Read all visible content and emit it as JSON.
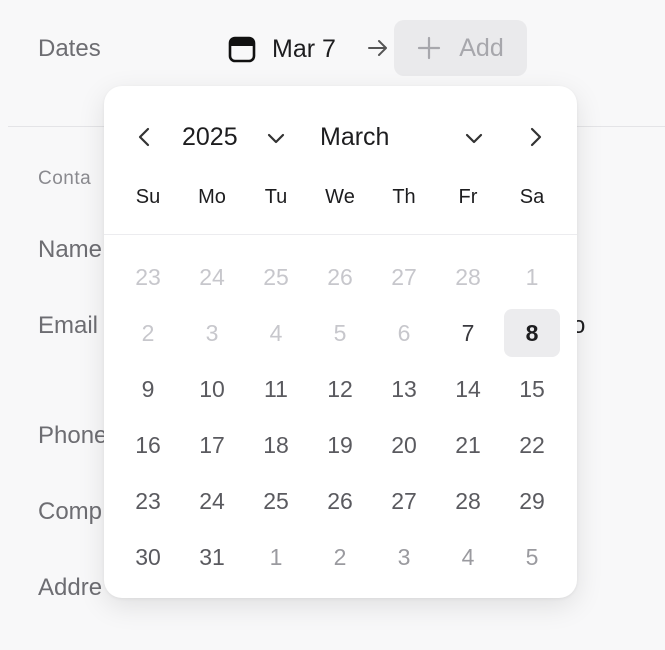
{
  "form": {
    "dates_label": "Dates",
    "section_label": "Conta",
    "name_label": "Name",
    "email_label": "Email",
    "email_value_tail": "co",
    "phone_label": "Phone",
    "company_label": "Comp",
    "address_label": "Addre"
  },
  "date_range": {
    "start_icon": "calendar-icon",
    "start_value": "Mar 7",
    "arrow_icon": "arrow-right-icon",
    "add_icon": "plus-icon",
    "add_label": "Add"
  },
  "calendar": {
    "prev_icon": "chevron-left-icon",
    "next_icon": "chevron-right-icon",
    "year": "2025",
    "month": "March",
    "weekdays": [
      "Su",
      "Mo",
      "Tu",
      "We",
      "Th",
      "Fr",
      "Sa"
    ],
    "days": [
      {
        "label": "23",
        "state": "out"
      },
      {
        "label": "24",
        "state": "out"
      },
      {
        "label": "25",
        "state": "out"
      },
      {
        "label": "26",
        "state": "out"
      },
      {
        "label": "27",
        "state": "out"
      },
      {
        "label": "28",
        "state": "out"
      },
      {
        "label": "1",
        "state": "out"
      },
      {
        "label": "2",
        "state": "out"
      },
      {
        "label": "3",
        "state": "out"
      },
      {
        "label": "4",
        "state": "out"
      },
      {
        "label": "5",
        "state": "out"
      },
      {
        "label": "6",
        "state": "out"
      },
      {
        "label": "7",
        "state": "current"
      },
      {
        "label": "8",
        "state": "selected"
      },
      {
        "label": "9",
        "state": "in"
      },
      {
        "label": "10",
        "state": "in"
      },
      {
        "label": "11",
        "state": "in"
      },
      {
        "label": "12",
        "state": "in"
      },
      {
        "label": "13",
        "state": "in"
      },
      {
        "label": "14",
        "state": "in"
      },
      {
        "label": "15",
        "state": "in"
      },
      {
        "label": "16",
        "state": "in"
      },
      {
        "label": "17",
        "state": "in"
      },
      {
        "label": "18",
        "state": "in"
      },
      {
        "label": "19",
        "state": "in"
      },
      {
        "label": "20",
        "state": "in"
      },
      {
        "label": "21",
        "state": "in"
      },
      {
        "label": "22",
        "state": "in"
      },
      {
        "label": "23",
        "state": "in"
      },
      {
        "label": "24",
        "state": "in"
      },
      {
        "label": "25",
        "state": "in"
      },
      {
        "label": "26",
        "state": "in"
      },
      {
        "label": "27",
        "state": "in"
      },
      {
        "label": "28",
        "state": "in"
      },
      {
        "label": "29",
        "state": "in"
      },
      {
        "label": "30",
        "state": "in"
      },
      {
        "label": "31",
        "state": "in"
      },
      {
        "label": "1",
        "state": "near"
      },
      {
        "label": "2",
        "state": "near"
      },
      {
        "label": "3",
        "state": "near"
      },
      {
        "label": "4",
        "state": "near"
      },
      {
        "label": "5",
        "state": "near"
      }
    ]
  }
}
